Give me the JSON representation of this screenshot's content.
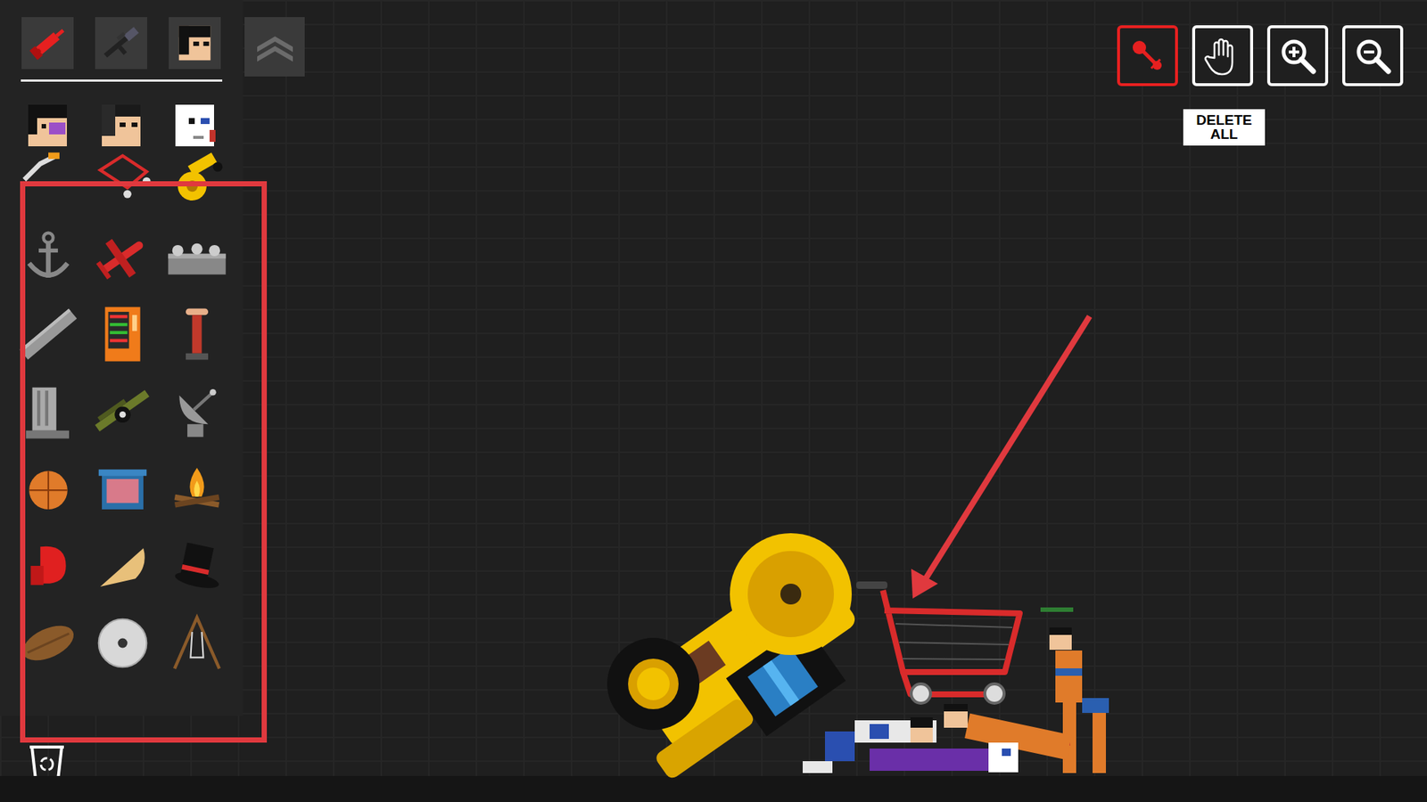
{
  "toolbar": {
    "tools": [
      {
        "kind": "pin",
        "selected": true
      },
      {
        "kind": "drag",
        "selected": false
      },
      {
        "kind": "zoom-in",
        "selected": false
      },
      {
        "kind": "zoom-out",
        "selected": false
      }
    ],
    "tooltip": "DELETE ALL"
  }
}
